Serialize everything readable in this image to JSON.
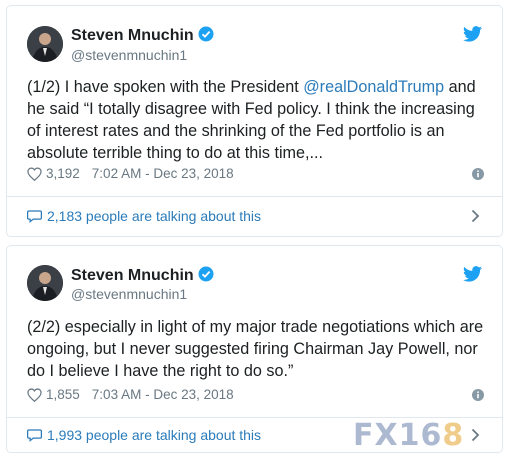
{
  "colors": {
    "link": "#2b7bb9",
    "twitter_blue": "#1da1f2",
    "muted": "#697882",
    "text": "#1c2022"
  },
  "tweets": [
    {
      "name": "Steven Mnuchin",
      "handle": "@stevenmnuchin1",
      "text_before": "(1/2) I have spoken with the President ",
      "mention": "@realDonaldTrump",
      "text_after": " and he said “I totally disagree with Fed policy. I think the increasing of interest rates and the shrinking of the Fed portfolio is an absolute terrible thing to do at this time,...",
      "likes": "3,192",
      "timestamp": "7:02 AM - Dec 23, 2018",
      "talking": "2,183 people are talking about this",
      "icons": [
        "verified-icon",
        "twitter-bird-icon",
        "heart-icon",
        "info-icon",
        "speech-bubble-icon",
        "chevron-right-icon"
      ]
    },
    {
      "name": "Steven Mnuchin",
      "handle": "@stevenmnuchin1",
      "text": "(2/2) especially in light of my major trade negotiations which are ongoing, but I never suggested firing Chairman Jay Powell, nor do I believe I have the right to do so.”",
      "likes": "1,855",
      "timestamp": "7:03 AM - Dec 23, 2018",
      "talking": "1,993 people are talking about this",
      "icons": [
        "verified-icon",
        "twitter-bird-icon",
        "heart-icon",
        "info-icon",
        "speech-bubble-icon",
        "chevron-right-icon"
      ]
    }
  ],
  "watermark": {
    "text": "FX16",
    "accent": "8"
  }
}
